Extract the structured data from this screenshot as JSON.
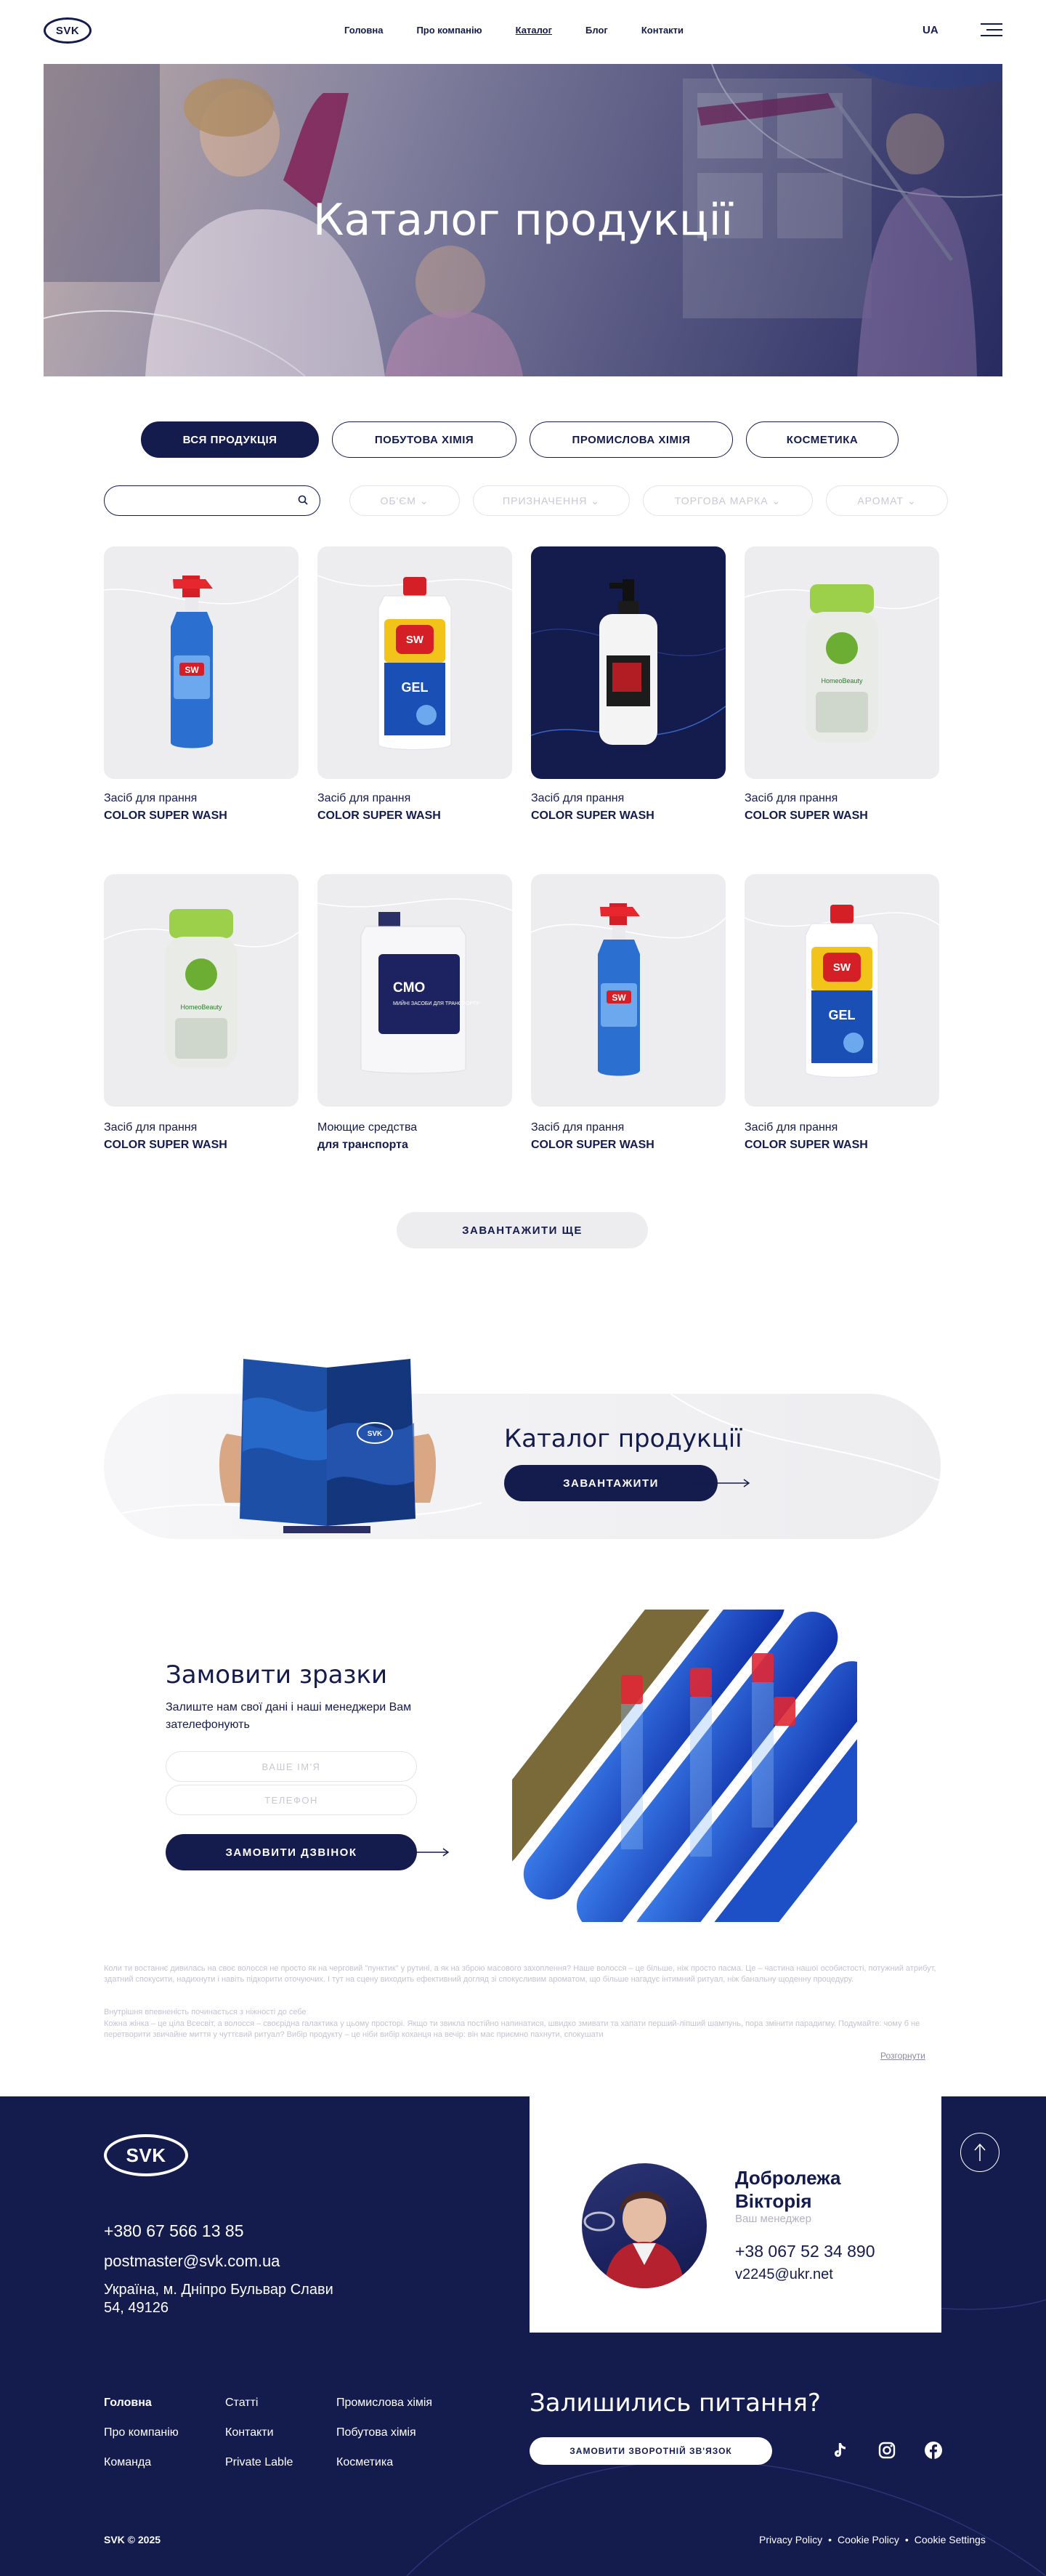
{
  "header": {
    "logo": "SVK",
    "nav": [
      "Головна",
      "Про компанію",
      "Каталог",
      "Блог",
      "Контакти"
    ],
    "lang": "UA"
  },
  "hero": {
    "title": "Каталог продукції"
  },
  "tabs": [
    "ВСЯ ПРОДУКЦІЯ",
    "ПОБУТОВА ХІМІЯ",
    "ПРОМИСЛОВА ХІМІЯ",
    "КОСМЕТИКА"
  ],
  "filters": {
    "search_value": "",
    "items": [
      "ОБ'ЄМ",
      "ПРИЗНАЧЕННЯ",
      "ТОРГОВА МАРКА",
      "АРОМАТ"
    ]
  },
  "products": [
    {
      "line1": "Засіб для прання",
      "line2": "COLOR SUPER WASH"
    },
    {
      "line1": "Засіб для прання",
      "line2": "COLOR SUPER WASH"
    },
    {
      "line1": "Засіб для прання",
      "line2": "COLOR SUPER WASH"
    },
    {
      "line1": "Засіб для прання",
      "line2": "COLOR SUPER WASH"
    },
    {
      "line1": "Засіб для прання",
      "line2": "COLOR SUPER WASH"
    },
    {
      "line1": "Моющие средства",
      "line2": "для транспорта"
    },
    {
      "line1": "Засіб для прання",
      "line2": "COLOR SUPER WASH"
    },
    {
      "line1": "Засіб для прання",
      "line2": "COLOR SUPER WASH"
    }
  ],
  "product_labels": {
    "sw": "SW",
    "gel": "GEL",
    "homeo": "HomeoBeauty",
    "cmo": "CMO",
    "cmo_sub": "МИЙНІ ЗАСОБИ ДЛЯ ТРАНСПОРТУ"
  },
  "load_more": "ЗАВАНТАЖИТИ ЩЕ",
  "catalog_banner": {
    "title": "Каталог продукції",
    "button": "ЗАВАНТАЖИТИ",
    "booklet_logo": "SVK"
  },
  "order": {
    "title": "Замовити зразки",
    "subtitle": "Залиште нам свої дані і наші менеджери Вам зателефонують",
    "name_placeholder": "ВАШЕ ІМ'Я",
    "phone_placeholder": "ТЕЛЕФОН",
    "button": "ЗАМОВИТИ ДЗВІНОК"
  },
  "seo_text": {
    "p1": "Коли ти востаннє дивилась на своє волосся не просто як на черговий \"пунктик\" у рутині, а як на зброю масового захоплення? Наше волосся – це більше, ніж просто пасма. Це – частина нашої особистості, потужний атрибут, здатний спокусити, надихнути і навіть підкорити оточуючих. І тут на сцену виходить ефективний догляд зі спокусливим ароматом, що більше нагадує інтимний ритуал, ніж банальну щоденну процедуру.",
    "p2": "Внутрішня впевненість починається з ніжності до себе",
    "p3": "Кожна жінка – це ціла Всесвіт, а волосся – своєрідна галактика у цьому просторі. Якщо ти звикла постійно напинатися, швидко змивати та хапати перший-ліпший шампунь, пора змінити парадигму. Подумайте: чому б не перетворити звичайне миття у чуттєвий ритуал? Вибір продукту – це ніби вибір коханця на вечір: він має приємно пахнути, спокушати",
    "collapse": "Розгорнути"
  },
  "footer": {
    "logo": "SVK",
    "phone": "+380 67 566 13 85",
    "email": "postmaster@svk.com.ua",
    "address": "Україна, м. Дніпро Бульвар Слави 54, 49126",
    "manager": {
      "name": "Добролежа Вікторія",
      "role": "Ваш менеджер",
      "phone": "+38 067 52 34 890",
      "email": "v2245@ukr.net"
    },
    "col1": [
      "Головна",
      "Про компанію",
      "Команда"
    ],
    "col2": [
      "Статті",
      "Контакти",
      "Private Lable"
    ],
    "col3": [
      "Промислова хімія",
      "Побутова хімія",
      "Косметика"
    ],
    "question": "Залишились питання?",
    "cta": "ЗАМОВИТИ ЗВОРОТНІЙ ЗВ'ЯЗОК",
    "social_icons": [
      "tiktok-icon",
      "instagram-icon",
      "facebook-icon"
    ],
    "copyright": "SVK © 2025",
    "legal": [
      "Privacy Policy",
      "Cookie Policy",
      "Cookie Settings"
    ],
    "legal_sep": "•"
  }
}
